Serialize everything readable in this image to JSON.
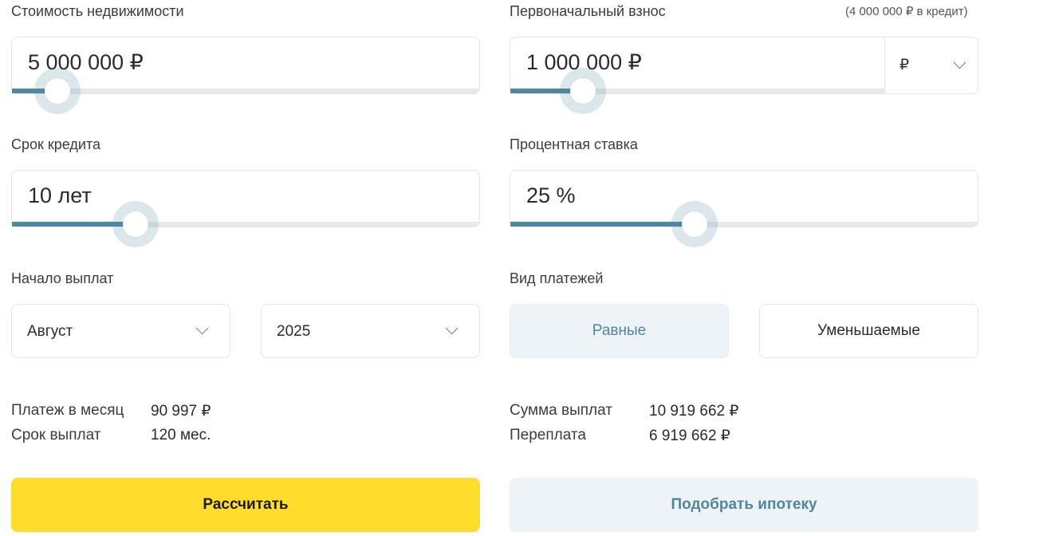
{
  "property_cost": {
    "label": "Стоимость недвижимости",
    "value": "5 000 000 ₽",
    "slider_fraction": 0.097
  },
  "down_payment": {
    "label": "Первоначальный взнос",
    "credit_hint": "(4 000 000 ₽ в кредит)",
    "value": "1 000 000 ₽",
    "slider_fraction": 0.193,
    "currency": "₽"
  },
  "loan_term": {
    "label": "Срок кредита",
    "value": "10 лет",
    "slider_fraction": 0.265
  },
  "interest_rate": {
    "label": "Процентная ставка",
    "value": "25 %",
    "slider_fraction": 0.395
  },
  "payment_start": {
    "label": "Начало выплат",
    "month": "Август",
    "year": "2025"
  },
  "payment_type": {
    "label": "Вид платежей",
    "options": [
      "Равные",
      "Уменьшаемые"
    ],
    "selected": "Равные"
  },
  "results_left": [
    {
      "label": "Платеж в месяц",
      "value": "90 997 ₽"
    },
    {
      "label": "Срок выплат",
      "value": "120 мес."
    }
  ],
  "results_right": [
    {
      "label": "Сумма выплат",
      "value": "10 919 662 ₽"
    },
    {
      "label": "Переплата",
      "value": "6 919 662 ₽"
    }
  ],
  "buttons": {
    "calculate": "Рассчитать",
    "find_mortgage": "Подобрать ипотеку"
  },
  "colors": {
    "accent": "#4f86a0",
    "primary_button": "#ffdd2d",
    "secondary_button_bg": "#eef3f7"
  }
}
